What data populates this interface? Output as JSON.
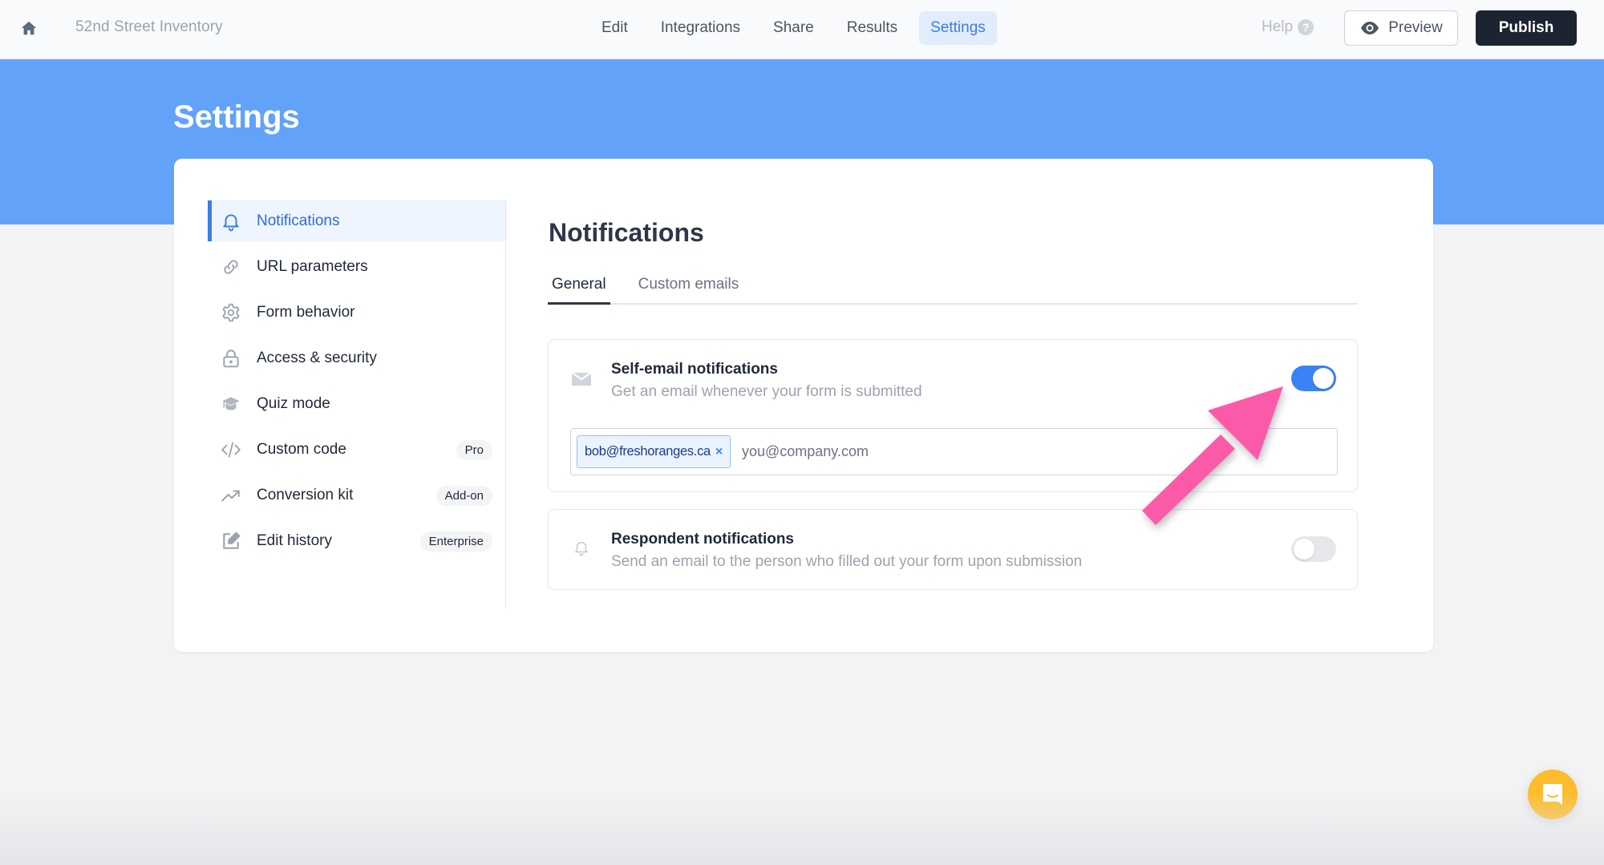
{
  "topbar": {
    "home_icon": "home-icon",
    "form_title": "52nd Street Inventory",
    "nav": [
      {
        "label": "Edit",
        "active": false
      },
      {
        "label": "Integrations",
        "active": false
      },
      {
        "label": "Share",
        "active": false
      },
      {
        "label": "Results",
        "active": false
      },
      {
        "label": "Settings",
        "active": true
      }
    ],
    "help_label": "Help",
    "help_icon_glyph": "?",
    "preview_label": "Preview",
    "publish_label": "Publish"
  },
  "page": {
    "title": "Settings"
  },
  "sidebar": {
    "items": [
      {
        "label": "Notifications",
        "icon": "bell-icon",
        "active": true,
        "badge": null
      },
      {
        "label": "URL parameters",
        "icon": "link-icon",
        "active": false,
        "badge": null
      },
      {
        "label": "Form behavior",
        "icon": "gear-icon",
        "active": false,
        "badge": null
      },
      {
        "label": "Access & security",
        "icon": "lock-icon",
        "active": false,
        "badge": null
      },
      {
        "label": "Quiz mode",
        "icon": "graduation-cap-icon",
        "active": false,
        "badge": null
      },
      {
        "label": "Custom code",
        "icon": "code-icon",
        "active": false,
        "badge": "Pro"
      },
      {
        "label": "Conversion kit",
        "icon": "trending-up-icon",
        "active": false,
        "badge": "Add-on"
      },
      {
        "label": "Edit history",
        "icon": "edit-icon",
        "active": false,
        "badge": "Enterprise"
      }
    ]
  },
  "main": {
    "title": "Notifications",
    "tabs": [
      {
        "label": "General",
        "active": true
      },
      {
        "label": "Custom emails",
        "active": false
      }
    ],
    "self_email": {
      "title": "Self-email notifications",
      "description": "Get an email whenever your form is submitted",
      "enabled": true,
      "recipients": [
        "bob@freshoranges.ca"
      ],
      "chip_remove_glyph": "×",
      "input_placeholder": "you@company.com",
      "input_value": ""
    },
    "respondent": {
      "title": "Respondent notifications",
      "description": "Send an email to the person who filled out your form upon submission",
      "enabled": false
    }
  },
  "colors": {
    "accent": "#3b82f6",
    "band": "#62a3f9",
    "publish_bg": "#1c2331",
    "annotation_arrow": "#fb5aa8",
    "chat_button": "#fbbd2c"
  }
}
